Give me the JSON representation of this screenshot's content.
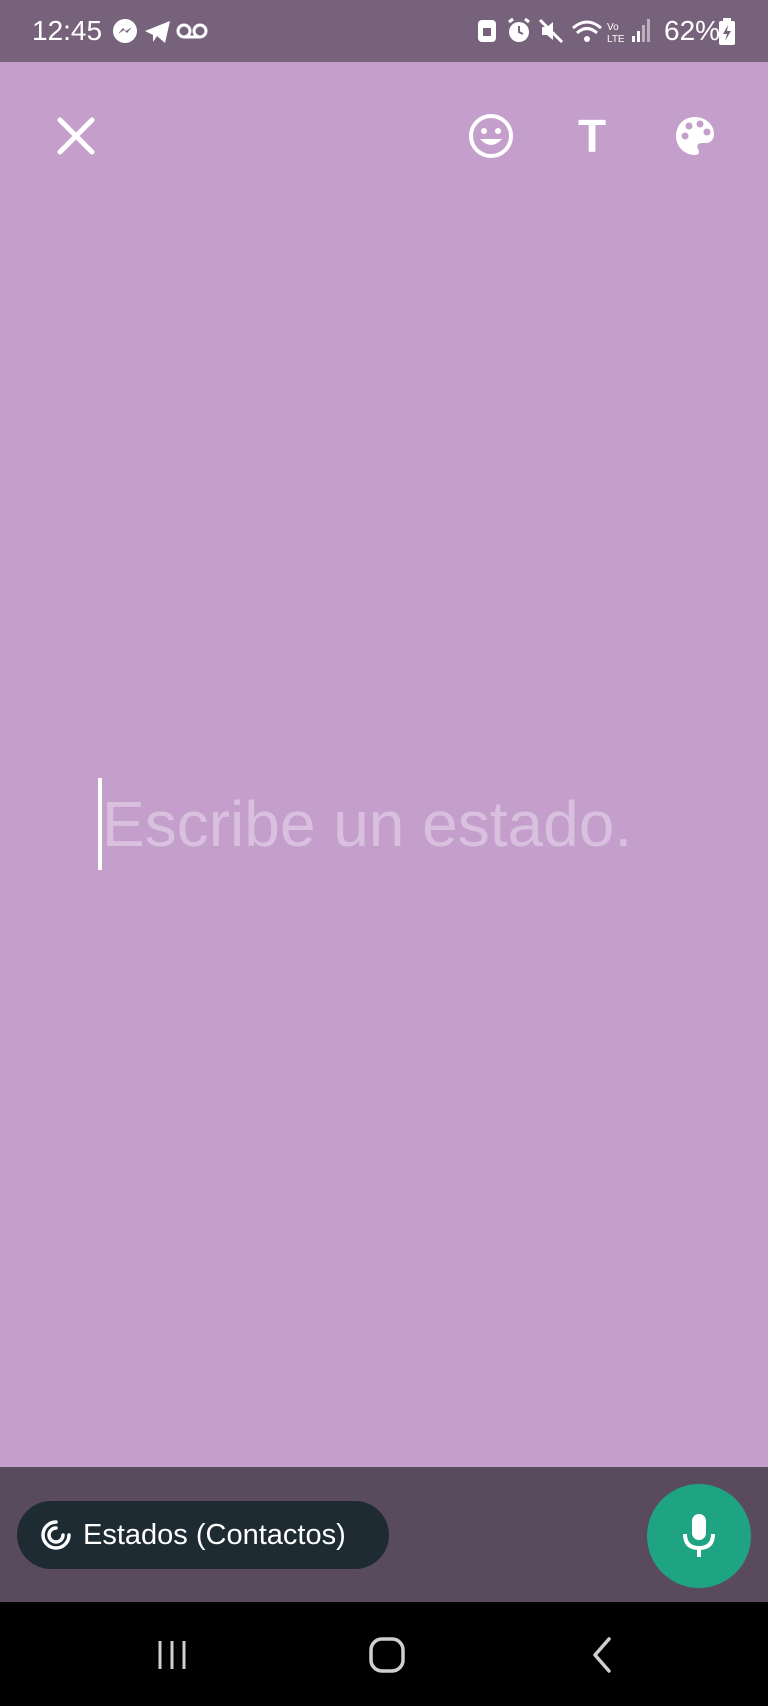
{
  "status_bar": {
    "time": "12:45",
    "battery": "62%",
    "left_icons": [
      "messenger-icon",
      "telegram-icon",
      "voicemail-icon"
    ],
    "right_icons": [
      "lock-app-icon",
      "alarm-icon",
      "mute-icon",
      "wifi-icon",
      "volte-icon",
      "signal-icon",
      "battery-icon"
    ]
  },
  "toolbar": {
    "close_icon": "close-icon",
    "emoji_icon": "emoji-icon",
    "text_style_glyph": "T",
    "palette_icon": "palette-icon"
  },
  "editor": {
    "placeholder": "Escribe un estado.",
    "value": "",
    "background_color": "#c49fcc"
  },
  "footer": {
    "audience_label": "Estados (Contactos)",
    "mic_color": "#1ea483"
  },
  "nav": {
    "buttons": [
      "recents",
      "home",
      "back"
    ]
  }
}
